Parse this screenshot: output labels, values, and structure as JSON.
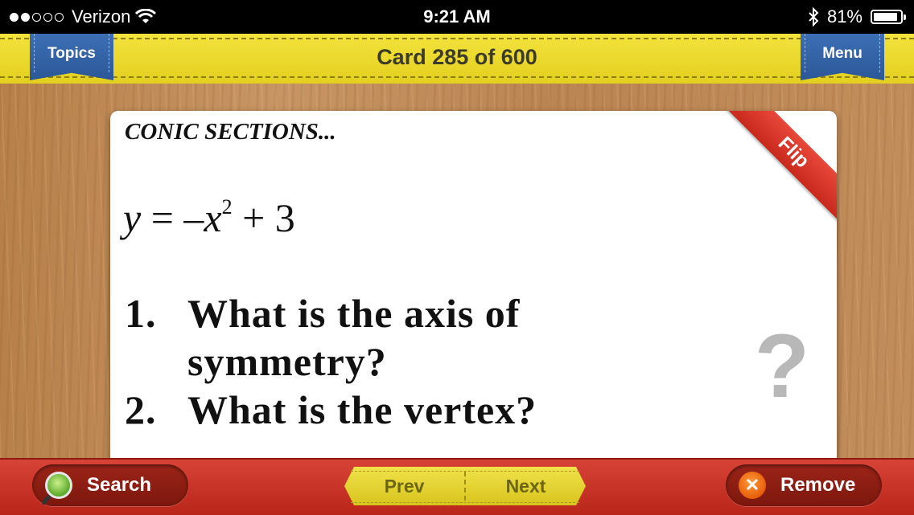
{
  "status_bar": {
    "carrier": "Verizon",
    "signal_bars_filled": 2,
    "signal_bars_total": 5,
    "time": "9:21 AM",
    "battery": "81%",
    "battery_level": 0.81
  },
  "header": {
    "title": "Card 285 of 600",
    "topics_label": "Topics",
    "menu_label": "Menu"
  },
  "card": {
    "heading": "CONIC SECTIONS...",
    "equation": {
      "lhs": "y",
      "eq": " = –",
      "var": "x",
      "exp": "2",
      "rest": " + 3"
    },
    "questions": [
      {
        "num": "1.",
        "line1": "What is the axis of",
        "line2": "symmetry?"
      },
      {
        "num": "2.",
        "line1": "What is the vertex?"
      }
    ],
    "flip_label": "Flip",
    "help_symbol": "?"
  },
  "toolbar": {
    "search_label": "Search",
    "prev_label": "Prev",
    "next_label": "Next",
    "remove_label": "Remove",
    "remove_symbol": "✕"
  },
  "colors": {
    "header_yellow": "#e9d72a",
    "ribbon_blue": "#2f5d9f",
    "footer_red": "#c8301f",
    "flip_red": "#d9372a"
  }
}
